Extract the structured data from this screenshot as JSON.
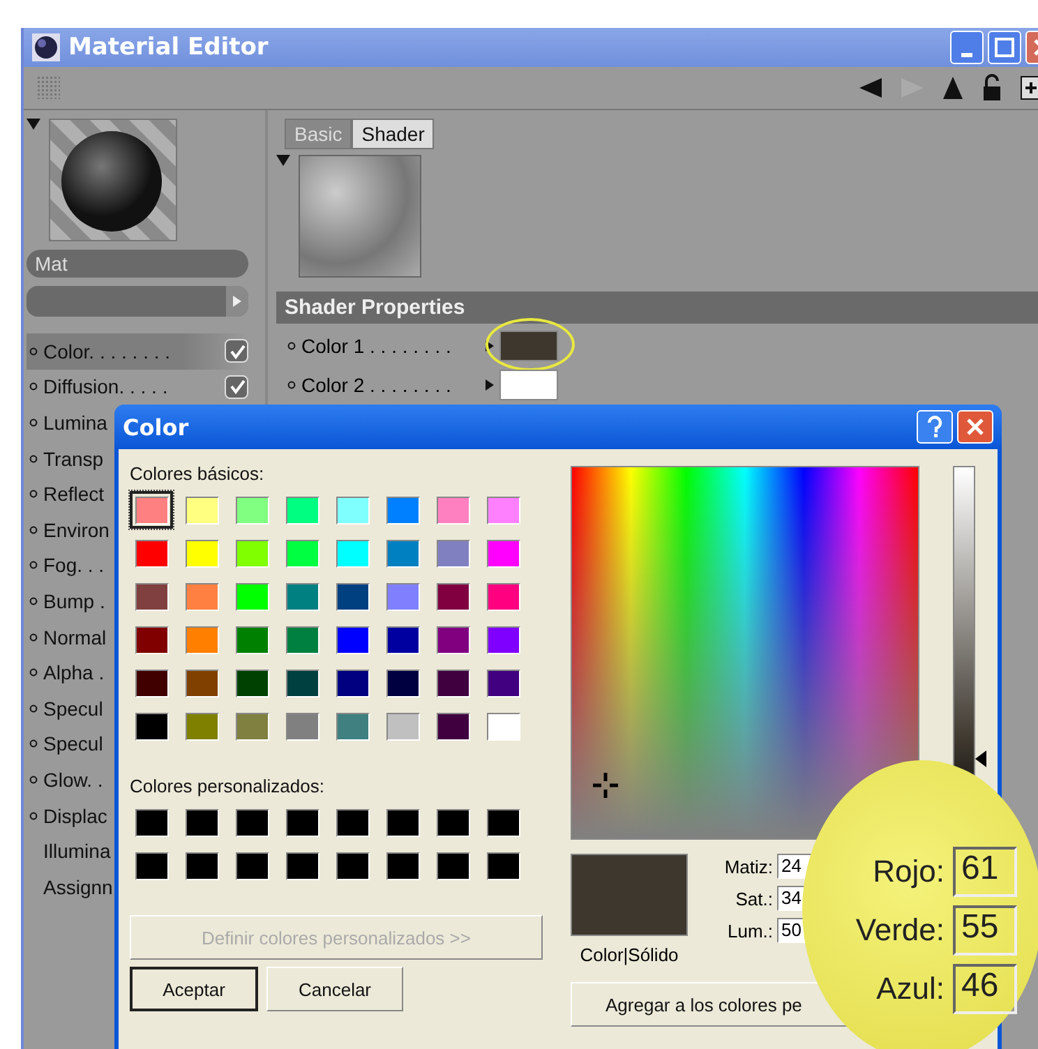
{
  "window": {
    "title": "Material Editor"
  },
  "material": {
    "name": "Mat"
  },
  "channels": [
    {
      "label": "Color. . . . . . . .",
      "kind": "channel",
      "selected": true,
      "checked": true
    },
    {
      "label": "Diffusion. . . . .",
      "kind": "channel",
      "selected": false,
      "checked": true
    },
    {
      "label": "Lumina",
      "kind": "channel",
      "selected": false
    },
    {
      "label": "Transp",
      "kind": "channel",
      "selected": false
    },
    {
      "label": "Reflect",
      "kind": "channel",
      "selected": false
    },
    {
      "label": "Environ",
      "kind": "channel",
      "selected": false
    },
    {
      "label": "Fog. . .",
      "kind": "channel",
      "selected": false
    },
    {
      "label": "Bump .",
      "kind": "channel",
      "selected": false
    },
    {
      "label": "Normal",
      "kind": "channel",
      "selected": false
    },
    {
      "label": "Alpha .",
      "kind": "channel",
      "selected": false
    },
    {
      "label": "Specul",
      "kind": "channel",
      "selected": false
    },
    {
      "label": "Specul",
      "kind": "channel",
      "selected": false
    },
    {
      "label": "Glow. .",
      "kind": "channel",
      "selected": false
    },
    {
      "label": "Displac",
      "kind": "channel",
      "selected": false
    },
    {
      "label": "Illumina",
      "kind": "setting",
      "selected": false
    },
    {
      "label": "Assignn",
      "kind": "setting",
      "selected": false
    }
  ],
  "tabs": [
    {
      "label": "Basic",
      "selected": false
    },
    {
      "label": "Shader",
      "selected": true
    }
  ],
  "shader_properties": {
    "title": "Shader Properties",
    "rows": [
      {
        "label": "Color 1 . . . . . . . .",
        "color": "#3d372e",
        "highlighted": true
      },
      {
        "label": "Color 2 . . . . . . . .",
        "color": "#ffffff",
        "highlighted": false
      }
    ]
  },
  "color_dialog": {
    "title": "Color",
    "basic_label": "Colores básicos:",
    "basic_colors": [
      {
        "color": "#ff8080",
        "selected": true
      },
      {
        "color": "#ffff80",
        "selected": false
      },
      {
        "color": "#80ff80",
        "selected": false
      },
      {
        "color": "#00ff80",
        "selected": false
      },
      {
        "color": "#80ffff",
        "selected": false
      },
      {
        "color": "#0080ff",
        "selected": false
      },
      {
        "color": "#ff80c0",
        "selected": false
      },
      {
        "color": "#ff80ff",
        "selected": false
      },
      {
        "color": "#ff0000",
        "selected": false
      },
      {
        "color": "#ffff00",
        "selected": false
      },
      {
        "color": "#80ff00",
        "selected": false
      },
      {
        "color": "#00ff40",
        "selected": false
      },
      {
        "color": "#00ffff",
        "selected": false
      },
      {
        "color": "#0080c0",
        "selected": false
      },
      {
        "color": "#8080c0",
        "selected": false
      },
      {
        "color": "#ff00ff",
        "selected": false
      },
      {
        "color": "#804040",
        "selected": false
      },
      {
        "color": "#ff8040",
        "selected": false
      },
      {
        "color": "#00ff00",
        "selected": false
      },
      {
        "color": "#008080",
        "selected": false
      },
      {
        "color": "#004080",
        "selected": false
      },
      {
        "color": "#8080ff",
        "selected": false
      },
      {
        "color": "#800040",
        "selected": false
      },
      {
        "color": "#ff0080",
        "selected": false
      },
      {
        "color": "#800000",
        "selected": false
      },
      {
        "color": "#ff8000",
        "selected": false
      },
      {
        "color": "#008000",
        "selected": false
      },
      {
        "color": "#008040",
        "selected": false
      },
      {
        "color": "#0000ff",
        "selected": false
      },
      {
        "color": "#0000a0",
        "selected": false
      },
      {
        "color": "#800080",
        "selected": false
      },
      {
        "color": "#8000ff",
        "selected": false
      },
      {
        "color": "#400000",
        "selected": false
      },
      {
        "color": "#804000",
        "selected": false
      },
      {
        "color": "#004000",
        "selected": false
      },
      {
        "color": "#004040",
        "selected": false
      },
      {
        "color": "#000080",
        "selected": false
      },
      {
        "color": "#000040",
        "selected": false
      },
      {
        "color": "#400040",
        "selected": false
      },
      {
        "color": "#400080",
        "selected": false
      },
      {
        "color": "#000000",
        "selected": false
      },
      {
        "color": "#808000",
        "selected": false
      },
      {
        "color": "#808040",
        "selected": false
      },
      {
        "color": "#808080",
        "selected": false
      },
      {
        "color": "#408080",
        "selected": false
      },
      {
        "color": "#c0c0c0",
        "selected": false
      },
      {
        "color": "#400040",
        "selected": false
      },
      {
        "color": "#ffffff",
        "selected": false
      }
    ],
    "custom_label": "Colores personalizados:",
    "custom_colors": [
      {
        "color": "#000000"
      },
      {
        "color": "#000000"
      },
      {
        "color": "#000000"
      },
      {
        "color": "#000000"
      },
      {
        "color": "#000000"
      },
      {
        "color": "#000000"
      },
      {
        "color": "#000000"
      },
      {
        "color": "#000000"
      },
      {
        "color": "#000000"
      },
      {
        "color": "#000000"
      },
      {
        "color": "#000000"
      },
      {
        "color": "#000000"
      },
      {
        "color": "#000000"
      },
      {
        "color": "#000000"
      },
      {
        "color": "#000000"
      },
      {
        "color": "#000000"
      }
    ],
    "define_button": {
      "label": "Definir colores personalizados >>",
      "disabled": true
    },
    "ok_button": "Aceptar",
    "cancel_button": "Cancelar",
    "preview": {
      "color": "#3d372e",
      "label": "Color|Sólido"
    },
    "hsl_fields": [
      {
        "label": "Matiz:",
        "value": "24"
      },
      {
        "label": "Sat.:",
        "value": "34"
      },
      {
        "label": "Lum.:",
        "value": "50"
      }
    ],
    "add_button": "Agregar a los colores pe"
  },
  "magnifier": {
    "fields": [
      {
        "label": "Rojo:",
        "value": "61"
      },
      {
        "label": "Verde:",
        "value": "55"
      },
      {
        "label": "Azul:",
        "value": "46"
      }
    ]
  }
}
